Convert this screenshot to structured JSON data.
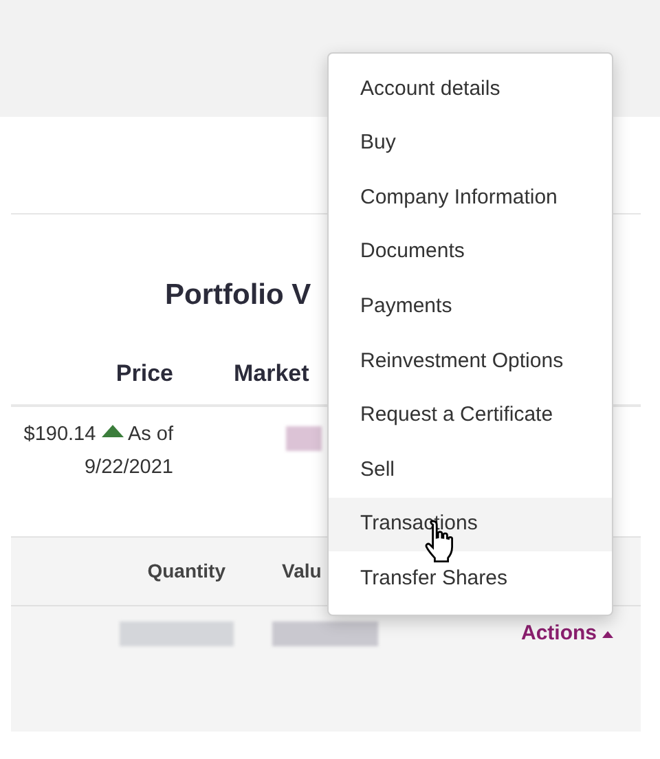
{
  "portfolio_title": "Portfolio V",
  "price_table": {
    "columns": [
      "Price",
      "Market"
    ],
    "rows": [
      {
        "price": "$190.14",
        "rising": true,
        "as_of": "As of 9/22/2021"
      }
    ]
  },
  "holdings_table": {
    "columns": [
      "Quantity",
      "Valu"
    ]
  },
  "actions_link": {
    "label": "Actions",
    "expanded": true
  },
  "actions_menu": [
    {
      "label": "Account details",
      "selected": false
    },
    {
      "label": "Buy",
      "selected": false
    },
    {
      "label": "Company Information",
      "selected": false
    },
    {
      "label": "Documents",
      "selected": false
    },
    {
      "label": "Payments",
      "selected": false
    },
    {
      "label": "Reinvestment Options",
      "selected": false
    },
    {
      "label": "Request a Certificate",
      "selected": false
    },
    {
      "label": "Sell",
      "selected": false
    },
    {
      "label": "Transactions",
      "selected": true
    },
    {
      "label": "Transfer Shares",
      "selected": false
    }
  ]
}
